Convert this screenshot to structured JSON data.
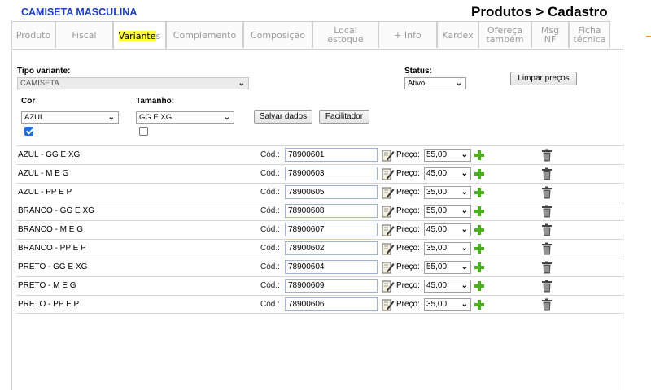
{
  "header": {
    "product_title": "CAMISETA MASCULINA",
    "breadcrumb": "Produtos > Cadastro"
  },
  "tabs": [
    {
      "label": "Produto"
    },
    {
      "label": "Fiscal"
    },
    {
      "label_highlight": "Variante",
      "label_rest": "s",
      "active": true
    },
    {
      "label": "Complemento"
    },
    {
      "label": "Composição"
    },
    {
      "label": "Local estoque"
    },
    {
      "label": "+ Info"
    },
    {
      "label": "Kardex"
    },
    {
      "label": "Ofereça também"
    },
    {
      "label": "Msg NF"
    },
    {
      "label": "Ficha técnica"
    }
  ],
  "form": {
    "tipo_variante_label": "Tipo variante:",
    "tipo_variante_value": "CAMISETA",
    "status_label": "Status:",
    "status_value": "Ativo",
    "limpar_precos_button": "Limpar preços",
    "cor_label": "Cor",
    "cor_value": "AZUL",
    "cor_checked": true,
    "tamanho_label": "Tamanho:",
    "tamanho_value": "GG E XG",
    "tamanho_checked": false,
    "salvar_button": "Salvar dados",
    "facilitador_button": "Facilitador"
  },
  "row_labels": {
    "cod": "Cód.:",
    "preco": "Preço:"
  },
  "variants": [
    {
      "name": "AZUL  -  GG E XG",
      "cod": "78900601",
      "preco": "55,00"
    },
    {
      "name": "AZUL  -  M E G",
      "cod": "78900603",
      "preco": "45,00"
    },
    {
      "name": "AZUL  -  PP E P",
      "cod": "78900605",
      "preco": "35,00"
    },
    {
      "name": "BRANCO  -  GG E XG",
      "cod": "78900608",
      "preco": "55,00"
    },
    {
      "name": "BRANCO  -  M E G",
      "cod": "78900607",
      "preco": "45,00"
    },
    {
      "name": "BRANCO  -  PP E P",
      "cod": "78900602",
      "preco": "35,00"
    },
    {
      "name": "PRETO  -  GG E XG",
      "cod": "78900604",
      "preco": "55,00"
    },
    {
      "name": "PRETO  -  M E G",
      "cod": "78900609",
      "preco": "45,00"
    },
    {
      "name": "PRETO  -  PP E P",
      "cod": "78900606",
      "preco": "35,00"
    }
  ],
  "icons": {
    "edit": "edit-note-icon",
    "add": "plus-icon",
    "delete": "trash-icon",
    "dropdown": "chevron-down-icon"
  },
  "colors": {
    "title_blue": "#1f3fbf",
    "highlight": "#ffff33",
    "plus_green": "#4caf1f",
    "checkbox_blue": "#1e6fd9"
  }
}
